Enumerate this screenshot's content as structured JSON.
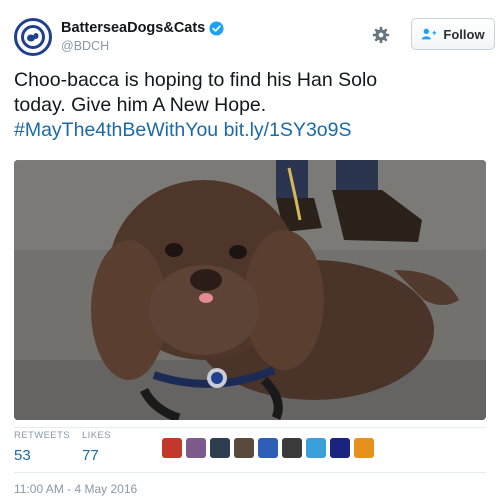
{
  "account": {
    "display_name": "BatterseaDogs&Cats",
    "handle": "@BDCH",
    "verified": true
  },
  "actions": {
    "follow_label": "Follow"
  },
  "tweet": {
    "text_line1": "Choo-bacca is hoping to find his Han Solo",
    "text_line2": "today. Give him A New Hope.",
    "hashtag": "#MayThe4thBeWithYou",
    "link": "bit.ly/1SY3o9S"
  },
  "stats": {
    "retweets_label": "RETWEETS",
    "retweets_value": "53",
    "likes_label": "LIKES",
    "likes_value": "77"
  },
  "likers": [
    {
      "icon": "liker-avatar",
      "color": "#c0392b"
    },
    {
      "icon": "liker-avatar",
      "color": "#7d5a8c"
    },
    {
      "icon": "liker-avatar",
      "color": "#2c3e50"
    },
    {
      "icon": "liker-avatar",
      "color": "#5b4a3a"
    },
    {
      "icon": "liker-avatar",
      "color": "#2e5fb8"
    },
    {
      "icon": "liker-avatar",
      "color": "#3b3b3b"
    },
    {
      "icon": "liker-avatar",
      "color": "#3aa0d8"
    },
    {
      "icon": "liker-avatar",
      "color": "#1a237e"
    },
    {
      "icon": "liker-avatar",
      "color": "#e8901c"
    }
  ],
  "timestamp": "11:00 AM - 4 May 2016",
  "colors": {
    "link": "#1b6aa5",
    "muted": "#8899a6",
    "verified": "#1da1f2",
    "brand_navy": "#1f3f8f"
  }
}
